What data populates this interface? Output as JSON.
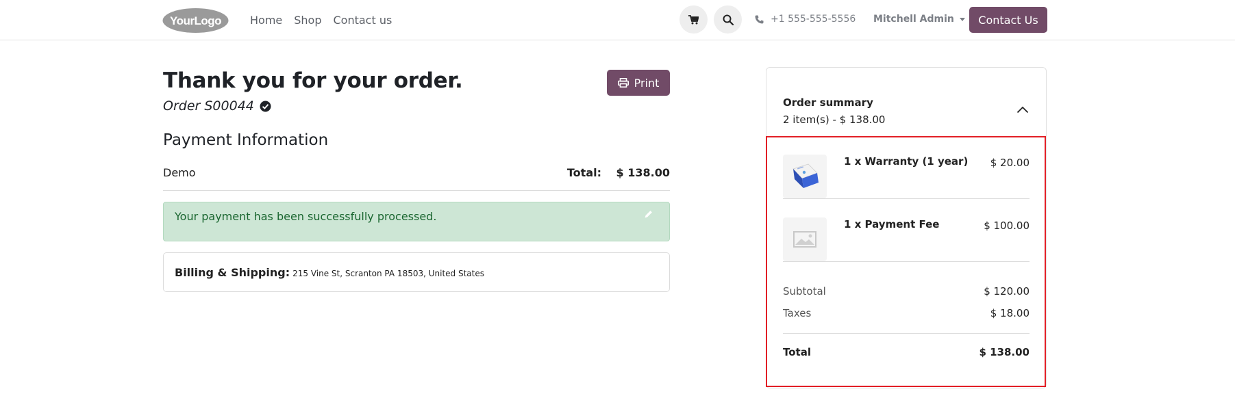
{
  "header": {
    "logo_text": "YourLogo",
    "nav": [
      "Home",
      "Shop",
      "Contact us"
    ],
    "phone": "+1 555-555-5556",
    "user": "Mitchell Admin",
    "contact_button": "Contact Us"
  },
  "confirmation": {
    "title": "Thank you for your order.",
    "order_ref": "Order S00044",
    "print_label": "Print"
  },
  "payment": {
    "section_title": "Payment Information",
    "method": "Demo",
    "total_label": "Total:",
    "total_value": "$ 138.00",
    "success_message": "Your payment has been successfully processed."
  },
  "billing": {
    "label": "Billing & Shipping:",
    "address": "215 Vine St, Scranton PA 18503, United States"
  },
  "summary": {
    "title": "Order summary",
    "subtitle": "2 item(s) -  $ 138.00",
    "items": [
      {
        "name": "1 x Warranty (1 year)",
        "price": "$ 20.00"
      },
      {
        "name": "1 x Payment Fee",
        "price": "$ 100.00"
      }
    ],
    "subtotal_label": "Subtotal",
    "subtotal_value": "$ 120.00",
    "taxes_label": "Taxes",
    "taxes_value": "$ 18.00",
    "total_label": "Total",
    "total_value": "$ 138.00"
  },
  "colors": {
    "brand": "#714b67",
    "success_bg": "#cde6d5",
    "success_text": "#1a6630",
    "highlight": "#e21f26"
  },
  "icons": [
    "cart-icon",
    "search-icon",
    "phone-icon",
    "caret-down-icon",
    "check-circle-icon",
    "printer-icon",
    "pencil-icon",
    "chevron-up-icon",
    "product-box-icon",
    "image-placeholder-icon"
  ]
}
